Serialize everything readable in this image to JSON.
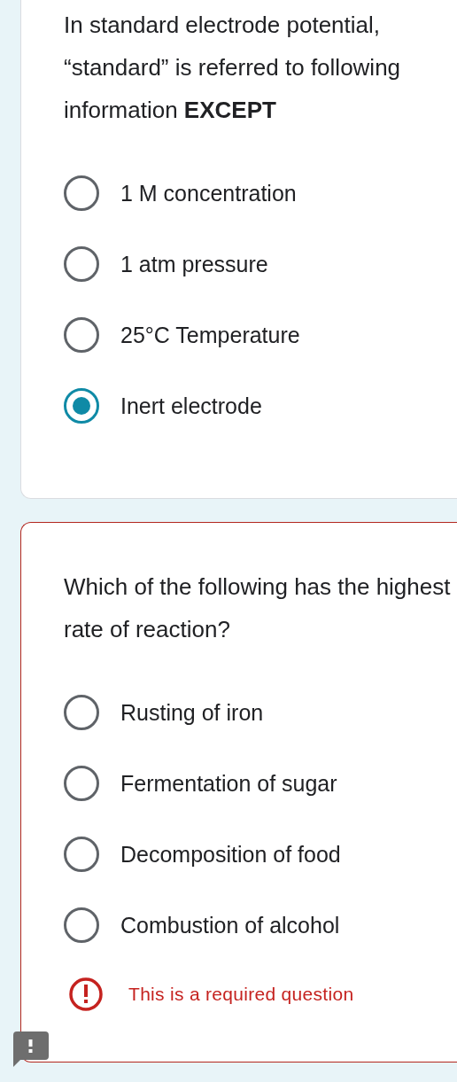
{
  "questions": [
    {
      "text": "In standard electrode potential, “standard” is referred to following information **EXCEPT**",
      "required_error": false,
      "options": [
        {
          "label": "1 M concentration",
          "selected": false
        },
        {
          "label": "1 atm pressure",
          "selected": false
        },
        {
          "label": "25°C Temperature",
          "selected": false
        },
        {
          "label": "Inert electrode",
          "selected": true
        }
      ]
    },
    {
      "text": "Which of the following has the highest rate of reaction?",
      "required_error": true,
      "error": "This is a required question",
      "options": [
        {
          "label": "Rusting of iron",
          "selected": false
        },
        {
          "label": "Fermentation of sugar",
          "selected": false
        },
        {
          "label": "Decomposition of food",
          "selected": false
        },
        {
          "label": "Combustion of alcohol",
          "selected": false
        }
      ]
    }
  ]
}
